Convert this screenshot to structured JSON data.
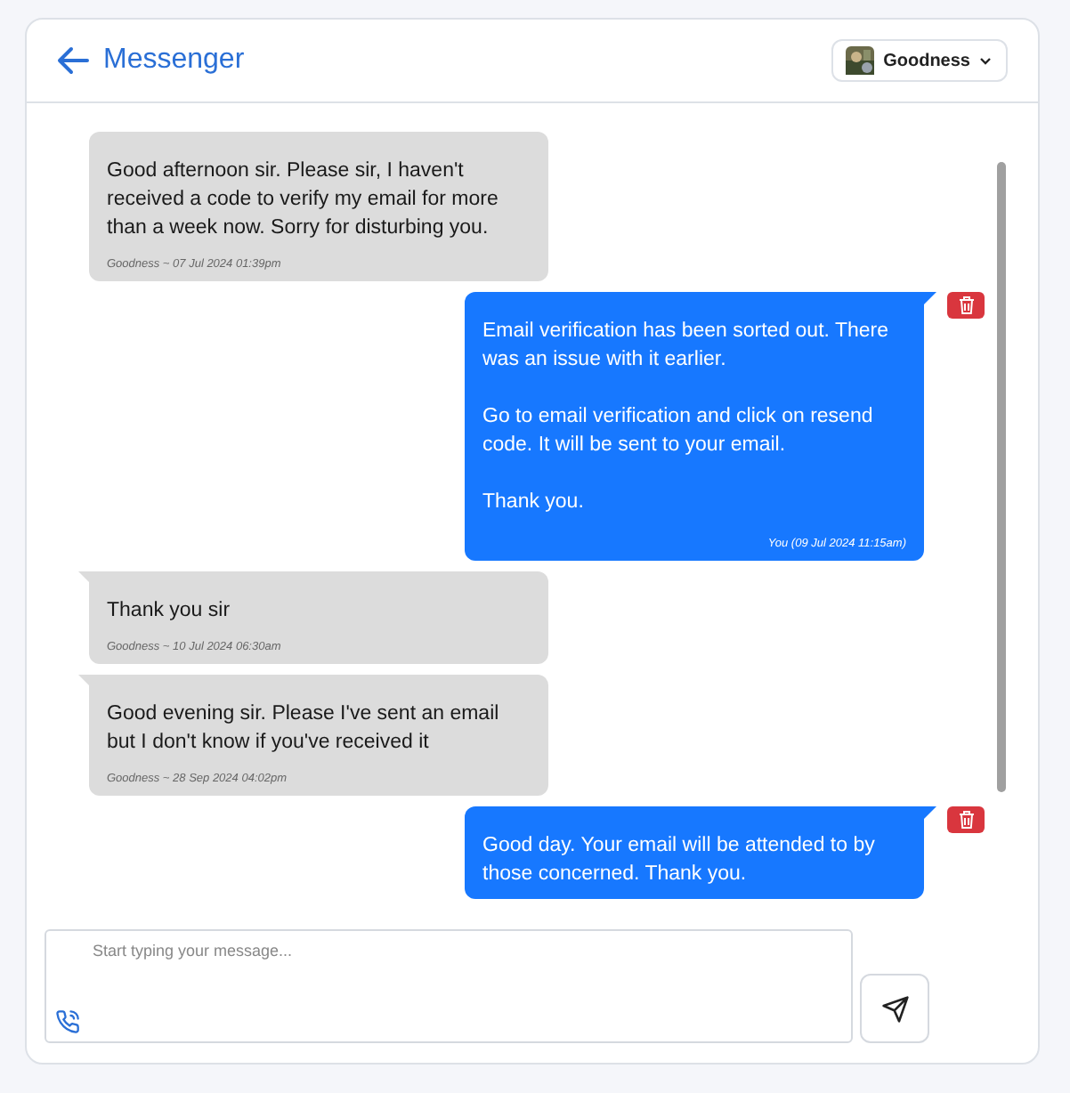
{
  "header": {
    "title": "Messenger",
    "user": {
      "name": "Goodness"
    }
  },
  "messages": [
    {
      "kind": "incoming",
      "text": "Good afternoon sir. Please sir, I haven't received a code to verify my email for more than a week now. Sorry for disturbing you.",
      "meta": "Goodness ~ 07 Jul 2024 01:39pm",
      "tail": false
    },
    {
      "kind": "outgoing",
      "text": "Email verification has been sorted out. There was an issue with it earlier.\n\nGo to email verification and click on resend code. It will be sent to your email.\n\nThank you.",
      "meta": "You (09 Jul 2024 11:15am)",
      "tail": true
    },
    {
      "kind": "incoming",
      "text": "Thank you sir",
      "meta": "Goodness ~ 10 Jul 2024 06:30am",
      "tail": true
    },
    {
      "kind": "incoming",
      "text": "Good evening sir. Please I've sent an email but I don't know if you've received it",
      "meta": "Goodness ~ 28 Sep 2024 04:02pm",
      "tail": true
    },
    {
      "kind": "outgoing",
      "text": "Good day. Your email will be attended to by those concerned. Thank you.",
      "tail": true
    }
  ],
  "composer": {
    "placeholder": "Start typing your message..."
  }
}
